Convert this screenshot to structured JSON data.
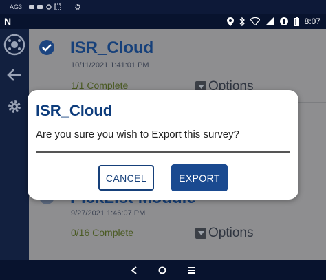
{
  "top_strip": {
    "device_label": "AG3"
  },
  "status_bar": {
    "app_logo": "N",
    "time": "8:07"
  },
  "surveys": [
    {
      "title": "ISR_Cloud",
      "date": "10/11/2021 1:41:01 PM",
      "status": "1/1 Complete",
      "options_label": "Options",
      "checked": true
    },
    {
      "title": "PickList Module",
      "date": "9/27/2021 1:46:07 PM",
      "status": "0/16 Complete",
      "options_label": "Options",
      "checked": false
    }
  ],
  "dialog": {
    "title": "ISR_Cloud",
    "message": "Are you sure you wish to Export this survey?",
    "cancel_label": "CANCEL",
    "export_label": "EXPORT"
  },
  "colors": {
    "accent": "#16407a",
    "primary_button": "#1a4a90",
    "sidebar": "#12203f",
    "overlay": "#8e8e90"
  },
  "icons": [
    "satellite-icon",
    "back-arrow-icon",
    "settings-gear-icon",
    "check-circle-icon",
    "options-box-icon",
    "nav-back-icon",
    "nav-home-icon",
    "nav-recents-icon"
  ]
}
